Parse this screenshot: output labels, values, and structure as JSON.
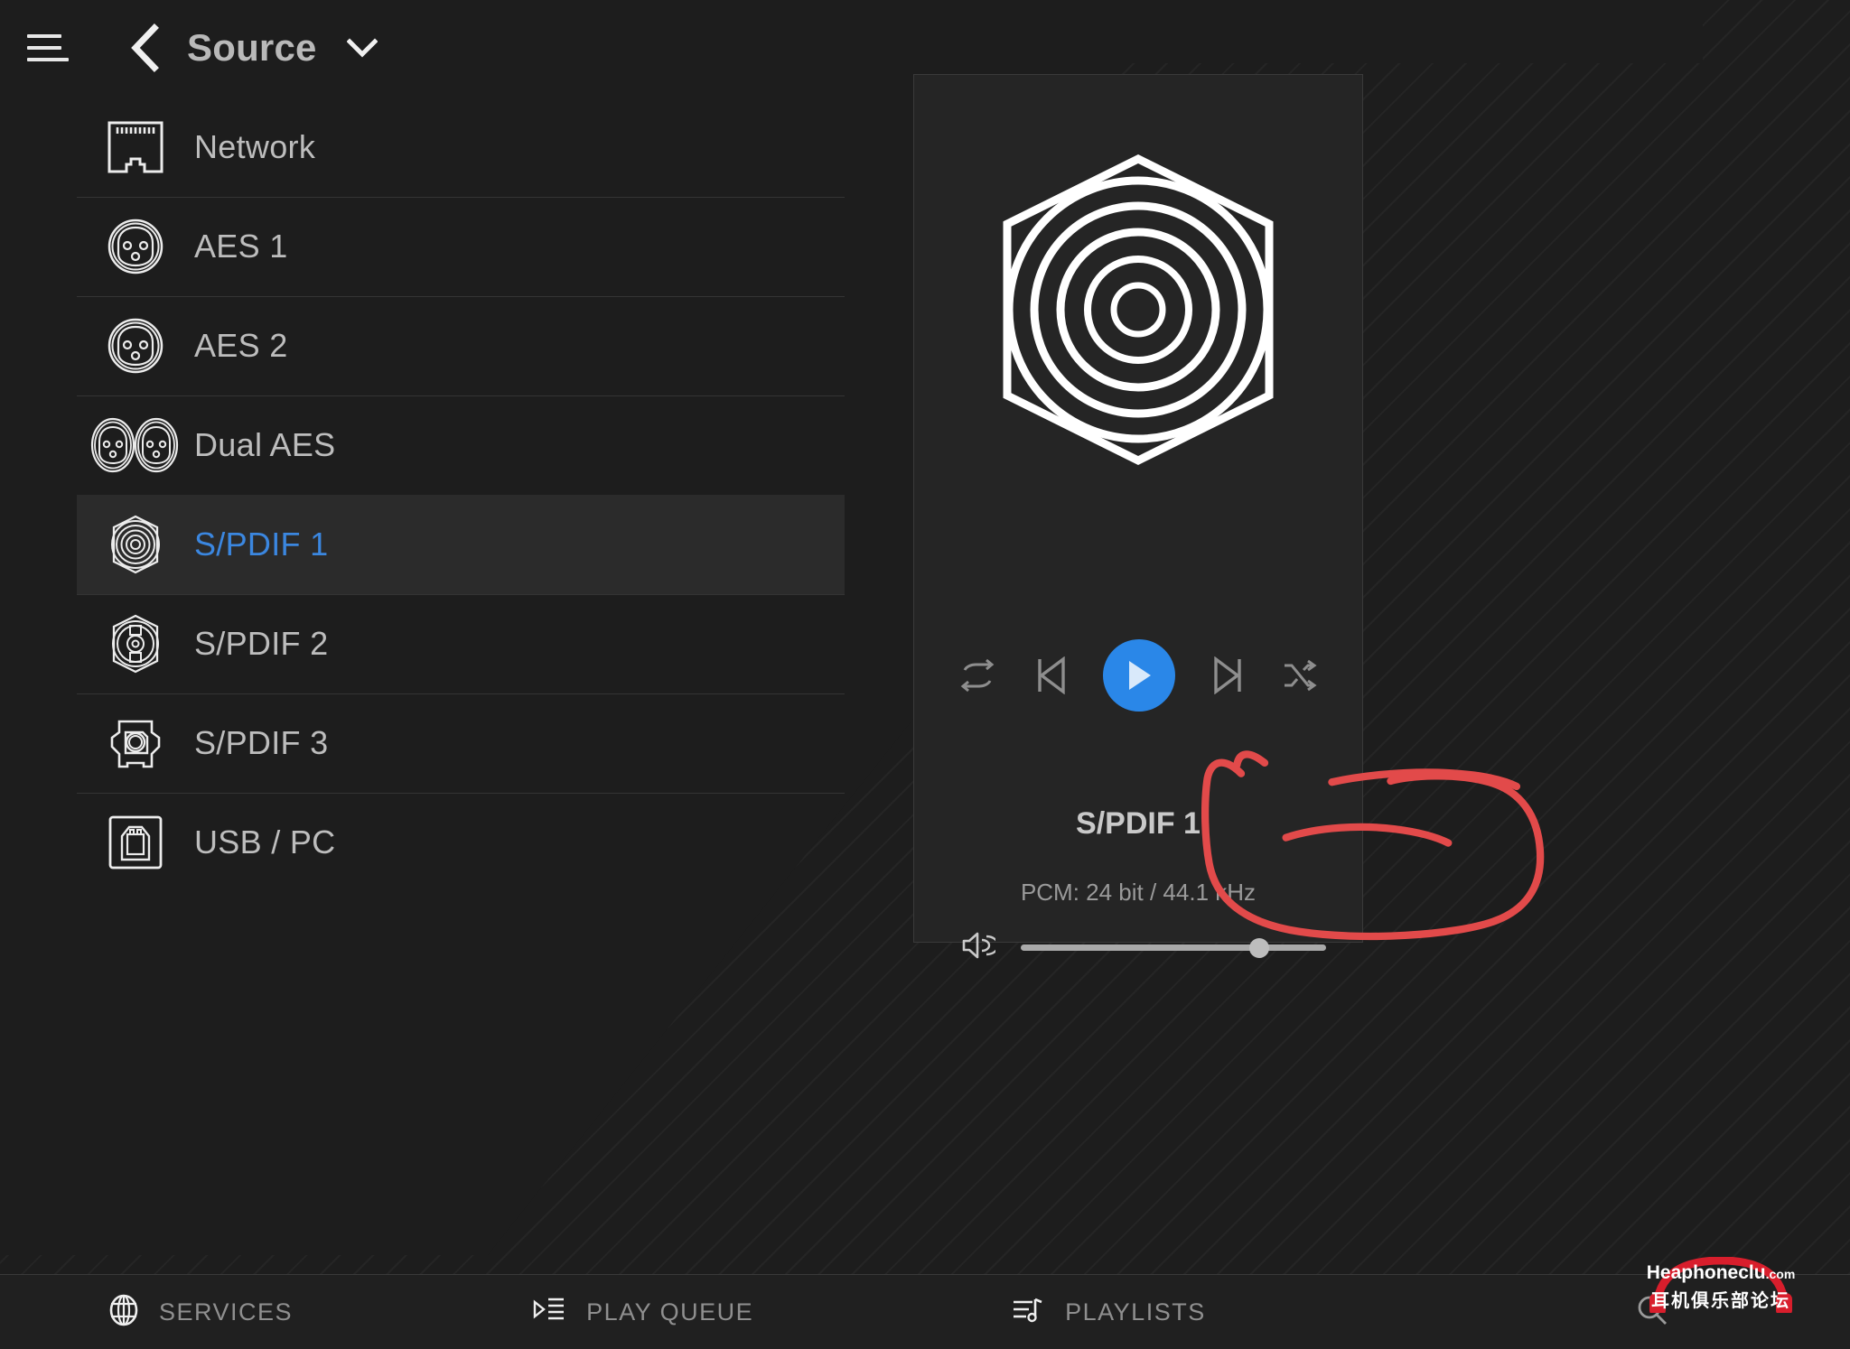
{
  "header": {
    "menu_icon": "hamburger-icon",
    "back_icon": "chevron-left-icon",
    "title": "Source",
    "caret_icon": "chevron-down-icon"
  },
  "source_list": {
    "items": [
      {
        "label": "Network",
        "icon": "rj45-network-jack-icon",
        "selected": false
      },
      {
        "label": "AES 1",
        "icon": "xlr-connector-icon",
        "selected": false
      },
      {
        "label": "AES 2",
        "icon": "xlr-connector-icon",
        "selected": false
      },
      {
        "label": "Dual AES",
        "icon": "dual-xlr-connector-icon",
        "selected": false
      },
      {
        "label": "S/PDIF 1",
        "icon": "rca-coax-connector-icon",
        "selected": true
      },
      {
        "label": "S/PDIF 2",
        "icon": "bnc-connector-icon",
        "selected": false
      },
      {
        "label": "S/PDIF 3",
        "icon": "toslink-optical-icon",
        "selected": false
      },
      {
        "label": "USB / PC",
        "icon": "usb-type-b-icon",
        "selected": false
      }
    ]
  },
  "now_playing": {
    "artwork_icon": "rca-coax-connector-artwork",
    "track_title": "S/PDIF 1",
    "format": "PCM: 24 bit / 44.1 kHz",
    "controls": {
      "repeat": "repeat-icon",
      "previous": "skip-previous-icon",
      "play": "play-icon",
      "next": "skip-next-icon",
      "shuffle": "shuffle-icon"
    },
    "volume": {
      "icon": "speaker-volume-icon",
      "level_percent": 78
    },
    "accent_color": "#2a87e8"
  },
  "bottom_nav": {
    "items": [
      {
        "label": "SERVICES",
        "icon": "globe-icon"
      },
      {
        "label": "PLAY QUEUE",
        "icon": "play-queue-icon"
      },
      {
        "label": "PLAYLISTS",
        "icon": "playlist-note-icon"
      }
    ],
    "search_icon": "search-icon"
  },
  "annotation": {
    "color": "#e14b4b",
    "shape": "hand-drawn-red-circle-and-underlines"
  },
  "watermark": {
    "line1_a": "Hea",
    "line1_b": "phoneclu",
    "line1_c": ".com",
    "line2": "耳机俱乐部论坛",
    "color": "#d81e2c"
  }
}
